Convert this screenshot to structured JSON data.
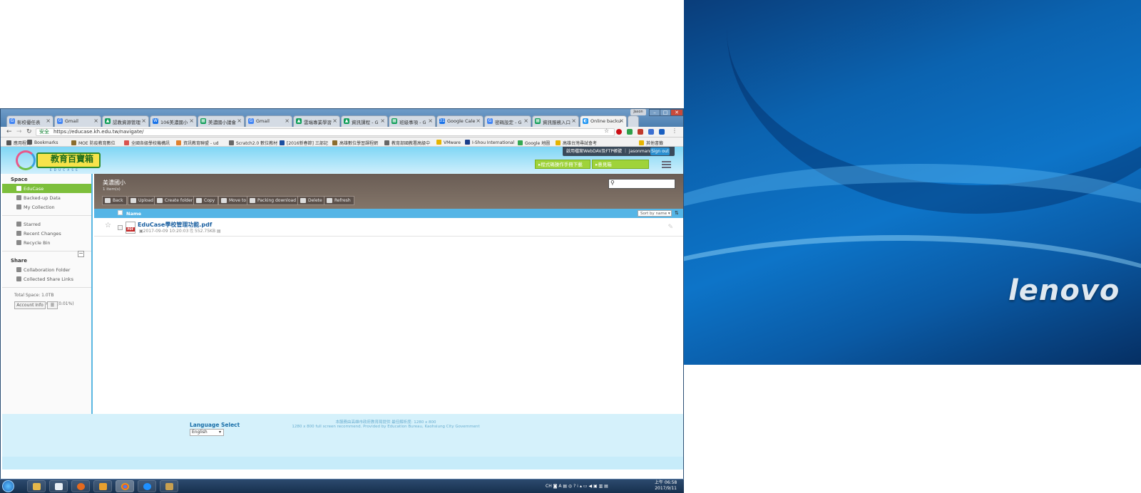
{
  "wallpaper": {
    "brand": "lenovo"
  },
  "window": {
    "user_button": "Jason",
    "tabs": [
      {
        "label": "彰校優任表",
        "color": "#4285f4",
        "glyph": "G"
      },
      {
        "label": "Gmail",
        "color": "#4285f4",
        "glyph": "G"
      },
      {
        "label": "認教資源管理",
        "color": "#0f9d58",
        "glyph": "▲"
      },
      {
        "label": "106美濃國小",
        "color": "#1a73e8",
        "glyph": "W"
      },
      {
        "label": "美濃國小議會",
        "color": "#0f9d58",
        "glyph": "▦"
      },
      {
        "label": "Gmail",
        "color": "#4285f4",
        "glyph": "G"
      },
      {
        "label": "雲端專業學習",
        "color": "#0f9d58",
        "glyph": "▲"
      },
      {
        "label": "資訊課程 - G",
        "color": "#0f9d58",
        "glyph": "▲"
      },
      {
        "label": "班級事項 - G",
        "color": "#0f9d58",
        "glyph": "▦"
      },
      {
        "label": "Google Cale",
        "color": "#1a73e8",
        "glyph": "31"
      },
      {
        "label": "密碼設定 - G",
        "color": "#4285f4",
        "glyph": "G"
      },
      {
        "label": "資訊服務入口",
        "color": "#0f9d58",
        "glyph": "▦"
      },
      {
        "label": "Online backu",
        "color": "#2196f3",
        "glyph": "◐"
      }
    ],
    "address": {
      "secure_label": "安全",
      "url": "https://educase.kh.edu.tw/navigate/"
    },
    "bookmarks": [
      {
        "label": "應用程式",
        "color": "#555"
      },
      {
        "label": "Bookmarks",
        "color": "#555"
      },
      {
        "label": "MOE 防疫教育數位",
        "color": "#8b6d2e"
      },
      {
        "label": "全國各級學校機構訊",
        "color": "#d9534f"
      },
      {
        "label": "資訊教育聯盟 - ud",
        "color": "#e0812e"
      },
      {
        "label": "Scratch2.0 數位教材",
        "color": "#666"
      },
      {
        "label": "[2016新春節] 三部記",
        "color": "#1a4ea0"
      },
      {
        "label": "高雄數位學習課程網",
        "color": "#8b6d2e"
      },
      {
        "label": "教育部國教署高級中",
        "color": "#666"
      },
      {
        "label": "VMware",
        "color": "#e6b400"
      },
      {
        "label": "I-Shou International",
        "color": "#1a3e8a"
      },
      {
        "label": "Google 地圖",
        "color": "#34a853"
      },
      {
        "label": "高雄台灣尋試會考",
        "color": "#e6b400"
      },
      {
        "label": "其他書籤",
        "color": "#e6b400"
      }
    ]
  },
  "site": {
    "logo_text": "教育百寶箱",
    "logo_sub": "E D U C A S E",
    "webdav_link": "啟用檔案WebDAV及FTP帳號",
    "username": "jasonmanr",
    "sign_out": "Sign out",
    "manual_btn": "▸程式碼操作手冊下載",
    "feedback_btn": "▸意見箱"
  },
  "sidebar": {
    "space_title": "Space",
    "space_items": [
      {
        "label": "EduCase",
        "active": true
      },
      {
        "label": "Backed-up Data",
        "active": false
      },
      {
        "label": "My Collection",
        "active": false
      }
    ],
    "misc_items": [
      {
        "label": "Starred"
      },
      {
        "label": "Recent Changes"
      },
      {
        "label": "Recycle Bin"
      }
    ],
    "share_title": "Share",
    "collapse_icon": "−",
    "share_items": [
      {
        "label": "Collaboration Folder"
      },
      {
        "label": "Collected Share Links"
      }
    ],
    "total_space": "Total Space: 1.0TB",
    "used_space": "Used Space: 1.0MB (0.01%)",
    "account_btn": "Account Info"
  },
  "folder": {
    "title": "美濃國小",
    "count": "1 item(s)",
    "toolbar": [
      "Back",
      "Upload",
      "Create folder",
      "Copy",
      "Move to",
      "Packing download",
      "Delete",
      "Refresh"
    ],
    "col_name": "Name",
    "sort": "Sort by name",
    "sort_dir": "⇅"
  },
  "files": [
    {
      "name": "EduCase學校管理功能.pdf",
      "date": "2017-09-09 10:20:03",
      "size": "552.75KB",
      "type_label": "PDF"
    }
  ],
  "footer": {
    "lang_label": "Language Select",
    "lang_value": "English",
    "note1": "本服務由高雄市政府教育局提供 最佳解析度: 1280 x 800",
    "note2": "1280 x 800 full screen recommend. Provided by Education Bureau, Kaohsiung City Government"
  },
  "taskbar": {
    "time": "上午 06:58",
    "date": "2017/9/11",
    "tray_lang": "CH"
  }
}
